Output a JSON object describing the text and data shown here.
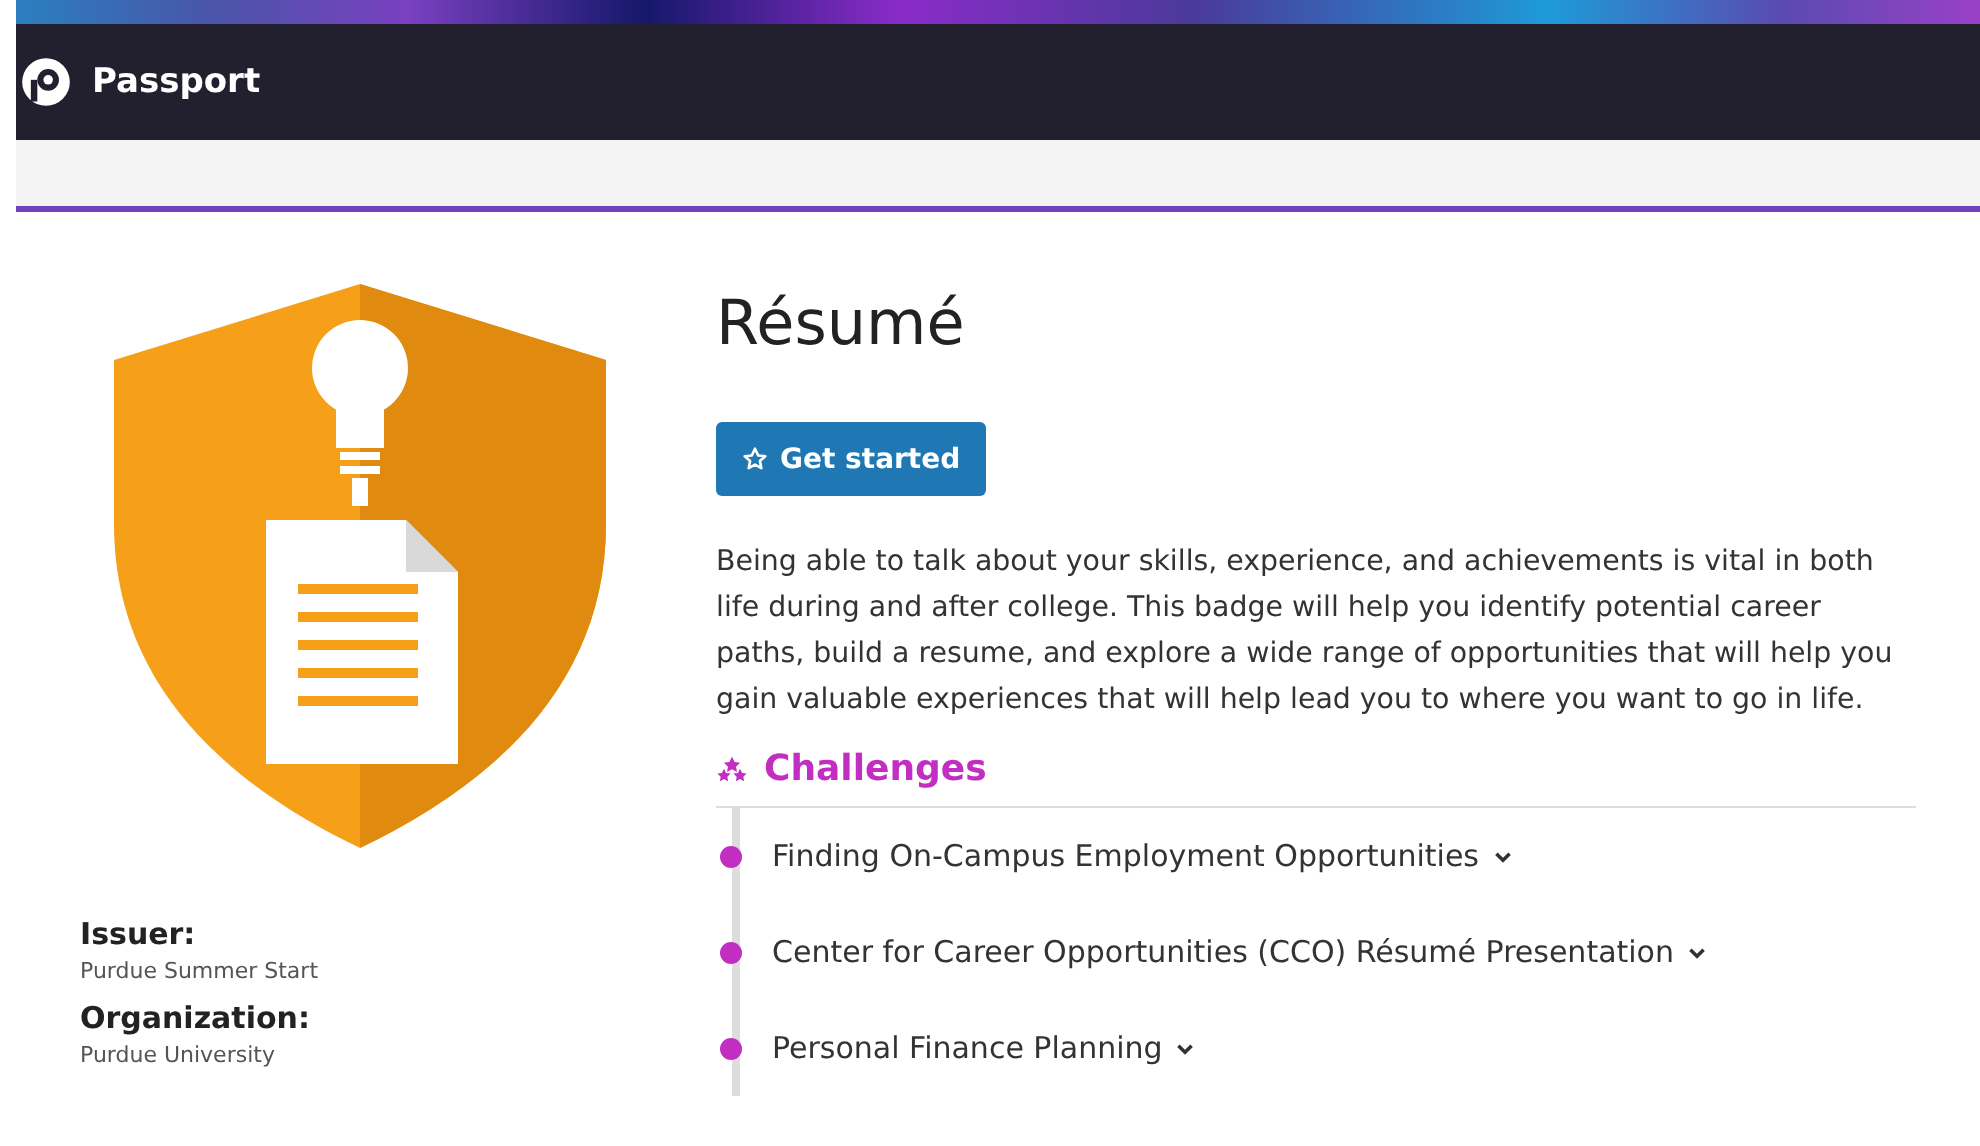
{
  "header": {
    "brand": "Passport"
  },
  "badge": {
    "title": "Résumé",
    "button": "Get started",
    "description": "Being able to talk about your skills, experience, and achievements is vital in both life during and after college.  This badge will help you identify potential career paths, build a resume, and explore a wide range of opportunities that will help you gain valuable experiences that will help lead you to where you want to go in life."
  },
  "meta": [
    {
      "label": "Issuer:",
      "value": "Purdue Summer Start"
    },
    {
      "label": "Organization:",
      "value": "Purdue University"
    }
  ],
  "challenges": {
    "heading": "Challenges",
    "items": [
      {
        "title": "Finding On-Campus Employment Opportunities",
        "expanded": false
      },
      {
        "title": "Center for Career Opportunities (CCO) Résumé Presentation",
        "expanded": false
      },
      {
        "title": "Personal Finance Planning",
        "expanded": false
      }
    ]
  }
}
